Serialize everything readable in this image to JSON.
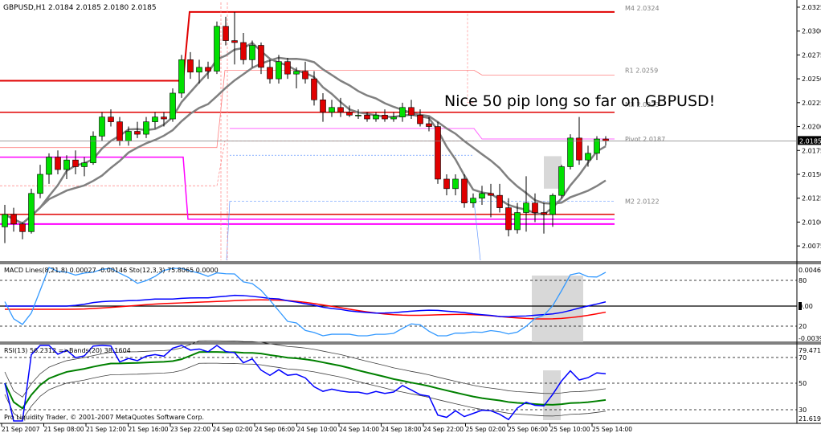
{
  "chart_data": {
    "type": "candlestick",
    "title": "GBPUSD,H1  2.0184 2.0185 2.0180 2.0185",
    "annotation": "Nice 50 pip long so far on GBPUSD!",
    "footer": "Pro Liquidity Trader, © 2001-2007 MetaQuotes Software Corp.",
    "price_ylim": [
      2.006,
      2.033
    ],
    "price_ticks": [
      "2.0325",
      "2.0300",
      "2.0275",
      "2.0250",
      "2.0225",
      "2.0200",
      "2.0175",
      "2.0150",
      "2.0125",
      "2.0100",
      "2.0075"
    ],
    "current_price": "2.0185",
    "x_tick_labels": [
      "21 Sep 2007",
      "21 Sep 08:00",
      "21 Sep 12:00",
      "21 Sep 16:00",
      "23 Sep 22:00",
      "24 Sep 02:00",
      "24 Sep 06:00",
      "24 Sep 10:00",
      "24 Sep 14:00",
      "24 Sep 18:00",
      "24 Sep 22:00",
      "25 Sep 02:00",
      "25 Sep 06:00",
      "25 Sep 10:00",
      "25 Sep 14:00"
    ],
    "candles": [
      [
        2.0095,
        2.0118,
        2.0078,
        2.0108
      ],
      [
        2.0108,
        2.0115,
        2.009,
        2.0098
      ],
      [
        2.0098,
        2.01,
        2.0082,
        2.009
      ],
      [
        2.009,
        2.0135,
        2.0088,
        2.013
      ],
      [
        2.013,
        2.016,
        2.0125,
        2.015
      ],
      [
        2.015,
        2.0172,
        2.014,
        2.0168
      ],
      [
        2.0168,
        2.0175,
        2.015,
        2.0155
      ],
      [
        2.0155,
        2.017,
        2.0145,
        2.0165
      ],
      [
        2.0165,
        2.0175,
        2.015,
        2.0158
      ],
      [
        2.0158,
        2.0168,
        2.0148,
        2.0162
      ],
      [
        2.0162,
        2.0195,
        2.016,
        2.019
      ],
      [
        2.019,
        2.0215,
        2.0185,
        2.021
      ],
      [
        2.021,
        2.0218,
        2.02,
        2.0205
      ],
      [
        2.0205,
        2.021,
        2.018,
        2.0185
      ],
      [
        2.0185,
        2.02,
        2.018,
        2.0195
      ],
      [
        2.0195,
        2.0205,
        2.0188,
        2.0192
      ],
      [
        2.0192,
        2.021,
        2.0188,
        2.0205
      ],
      [
        2.0205,
        2.0215,
        2.0198,
        2.021
      ],
      [
        2.021,
        2.0215,
        2.02,
        2.0208
      ],
      [
        2.0208,
        2.024,
        2.0205,
        2.0235
      ],
      [
        2.0235,
        2.0275,
        2.023,
        2.027
      ],
      [
        2.027,
        2.0278,
        2.025,
        2.0257
      ],
      [
        2.0257,
        2.027,
        2.0245,
        2.0262
      ],
      [
        2.0262,
        2.0268,
        2.025,
        2.0258
      ],
      [
        2.0258,
        2.031,
        2.0255,
        2.0305
      ],
      [
        2.0305,
        2.0315,
        2.0285,
        2.029
      ],
      [
        2.029,
        2.032,
        2.0265,
        2.0288
      ],
      [
        2.0288,
        2.0298,
        2.0265,
        2.027
      ],
      [
        2.027,
        2.029,
        2.0262,
        2.0285
      ],
      [
        2.0285,
        2.0288,
        2.0255,
        2.0262
      ],
      [
        2.0262,
        2.027,
        2.0245,
        2.025
      ],
      [
        2.025,
        2.0275,
        2.0245,
        2.0268
      ],
      [
        2.0268,
        2.0272,
        2.025,
        2.0255
      ],
      [
        2.0255,
        2.0262,
        2.024,
        2.0258
      ],
      [
        2.0258,
        2.0268,
        2.0245,
        2.025
      ],
      [
        2.025,
        2.0258,
        2.0222,
        2.0228
      ],
      [
        2.0228,
        2.0235,
        2.0205,
        2.0215
      ],
      [
        2.0215,
        2.0228,
        2.021,
        2.022
      ],
      [
        2.022,
        2.023,
        2.021,
        2.0215
      ],
      [
        2.0215,
        2.0222,
        2.021,
        2.0212
      ],
      [
        2.0212,
        2.0218,
        2.0208,
        2.0212
      ],
      [
        2.0212,
        2.0215,
        2.0205,
        2.0208
      ],
      [
        2.0208,
        2.0215,
        2.0205,
        2.0212
      ],
      [
        2.0212,
        2.0218,
        2.0205,
        2.0208
      ],
      [
        2.0208,
        2.0215,
        2.0205,
        2.021
      ],
      [
        2.021,
        2.0225,
        2.0205,
        2.022
      ],
      [
        2.022,
        2.0228,
        2.0208,
        2.0212
      ],
      [
        2.0212,
        2.0218,
        2.02,
        2.0203
      ],
      [
        2.0203,
        2.021,
        2.0195,
        2.02
      ],
      [
        2.02,
        2.0205,
        2.014,
        2.0145
      ],
      [
        2.0145,
        2.015,
        2.0128,
        2.0135
      ],
      [
        2.0135,
        2.015,
        2.0128,
        2.0145
      ],
      [
        2.0145,
        2.015,
        2.0115,
        2.012
      ],
      [
        2.012,
        2.013,
        2.0115,
        2.0125
      ],
      [
        2.0125,
        2.0138,
        2.0118,
        2.013
      ],
      [
        2.013,
        2.014,
        2.0105,
        2.0128
      ],
      [
        2.0128,
        2.014,
        2.011,
        2.0115
      ],
      [
        2.0115,
        2.0125,
        2.0085,
        2.0092
      ],
      [
        2.0092,
        2.012,
        2.0088,
        2.011
      ],
      [
        2.011,
        2.0148,
        2.009,
        2.012
      ],
      [
        2.012,
        2.013,
        2.01,
        2.011
      ],
      [
        2.011,
        2.012,
        2.0088,
        2.0108
      ],
      [
        2.0108,
        2.013,
        2.0095,
        2.0128
      ],
      [
        2.0128,
        2.016,
        2.0125,
        2.0158
      ],
      [
        2.0158,
        2.0192,
        2.0155,
        2.0188
      ],
      [
        2.0188,
        2.021,
        2.016,
        2.0165
      ],
      [
        2.0165,
        2.018,
        2.0158,
        2.0172
      ],
      [
        2.0172,
        2.019,
        2.0165,
        2.0187
      ],
      [
        2.0187,
        2.019,
        2.018,
        2.0185
      ]
    ],
    "pivot_labels": [
      {
        "text": "M4 2.0324",
        "price": 2.0324
      },
      {
        "text": "R1 2.0259",
        "price": 2.0259
      },
      {
        "text": "M3 2.0223",
        "price": 2.0223
      },
      {
        "text": "Pivot 2.0187",
        "price": 2.0187
      },
      {
        "text": "M2 2.0122",
        "price": 2.0122
      }
    ],
    "macd": {
      "label": "MACD Lines(8,21,8) 0.00027 -0.00146  Sto(12,3,3) 75.8065 0.0000",
      "ticks": [
        "0.00464",
        "80",
        "0.00",
        "20",
        "-0.00392"
      ]
    },
    "rsi": {
      "label": "RSI(13) 56.2312  =>Bands(20) 38.1604",
      "ticks": [
        "79.4712",
        "70",
        "50",
        "30",
        "21.6197"
      ]
    }
  },
  "colors": {
    "bull": "#00e000",
    "bear": "#e00000",
    "ma": "#808080",
    "red_line": "#e00000",
    "magenta": "#ff00ff",
    "blue": "#0000ff",
    "light_blue": "#3399ff",
    "green": "#008000",
    "grid": "#c0c0c0"
  }
}
